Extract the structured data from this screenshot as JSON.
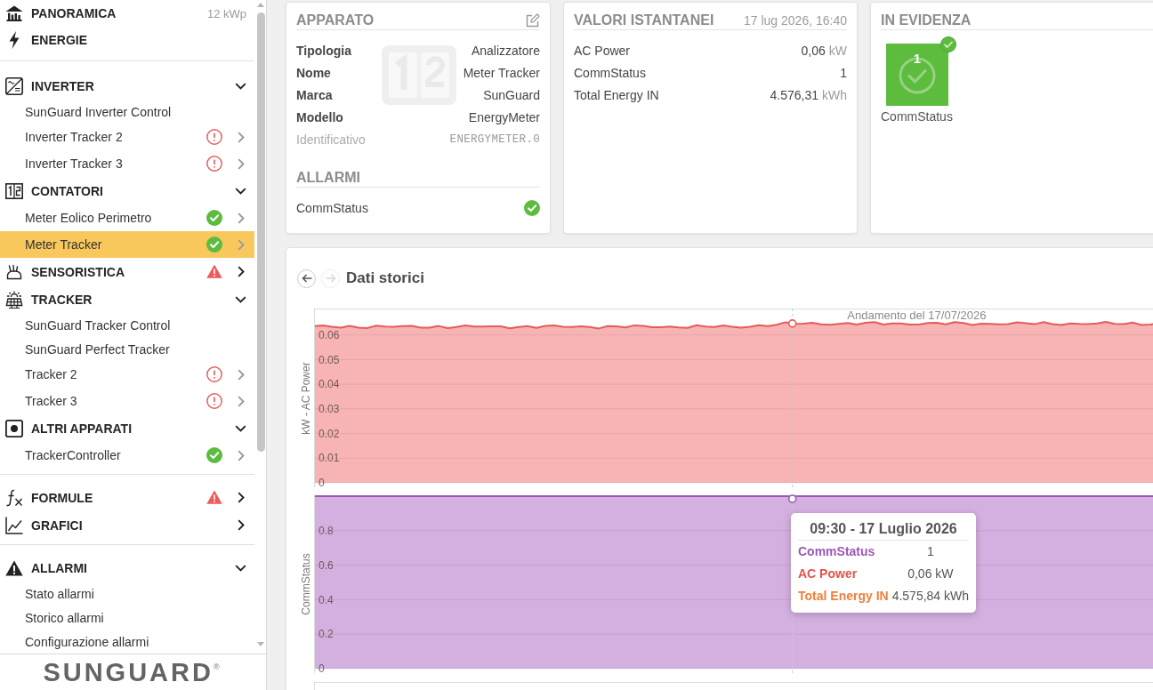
{
  "sidebar": {
    "groups": [
      {
        "sections": [
          {
            "label": "PANORAMICA",
            "value": "12 kWp"
          },
          {
            "label": "ENERGIE"
          }
        ]
      },
      {
        "sections": [
          {
            "label": "INVERTER",
            "warning": false,
            "expanded": true,
            "children": [
              {
                "label": "SunGuard Inverter Control",
                "alarm": false,
                "ok": false,
                "has_submenu": false,
                "selected": false
              },
              {
                "label": "Inverter Tracker 2",
                "alarm": true,
                "ok": false,
                "has_submenu": true,
                "selected": false
              },
              {
                "label": "Inverter Tracker 3",
                "alarm": true,
                "ok": false,
                "has_submenu": true,
                "selected": false
              }
            ]
          },
          {
            "label": "CONTATORI",
            "warning": false,
            "expanded": true,
            "children": [
              {
                "label": "Meter Eolico Perimetro",
                "alarm": false,
                "ok": true,
                "has_submenu": true,
                "selected": false
              },
              {
                "label": "Meter Tracker",
                "alarm": false,
                "ok": true,
                "has_submenu": true,
                "selected": true
              }
            ]
          },
          {
            "label": "SENSORISTICA",
            "warning": true,
            "expanded": false
          },
          {
            "label": "TRACKER",
            "warning": false,
            "expanded": true,
            "children": [
              {
                "label": "SunGuard Tracker Control",
                "alarm": false,
                "ok": false,
                "has_submenu": false,
                "selected": false
              },
              {
                "label": "SunGuard Perfect Tracker",
                "alarm": false,
                "ok": false,
                "has_submenu": false,
                "selected": false
              },
              {
                "label": "Tracker 2",
                "alarm": true,
                "ok": false,
                "has_submenu": true,
                "selected": false
              },
              {
                "label": "Tracker 3",
                "alarm": true,
                "ok": false,
                "has_submenu": true,
                "selected": false
              }
            ]
          },
          {
            "label": "ALTRI APPARATI",
            "warning": false,
            "expanded": true,
            "children": [
              {
                "label": "TrackerController",
                "alarm": false,
                "ok": true,
                "has_submenu": true,
                "selected": false
              }
            ]
          }
        ]
      },
      {
        "sections": [
          {
            "label": "FORMULE",
            "warning": true,
            "expanded": false
          },
          {
            "label": "GRAFICI",
            "warning": false,
            "expanded": false
          }
        ]
      },
      {
        "sections": [
          {
            "label": "ALLARMI",
            "warning": false,
            "expanded": true,
            "children": [
              {
                "label": "Stato allarmi",
                "alarm": false,
                "ok": false,
                "has_submenu": false,
                "selected": false
              },
              {
                "label": "Storico allarmi",
                "alarm": false,
                "ok": false,
                "has_submenu": false,
                "selected": false
              },
              {
                "label": "Configurazione allarmi",
                "alarm": false,
                "ok": false,
                "has_submenu": false,
                "selected": false
              }
            ]
          }
        ]
      }
    ],
    "logo": {
      "text": "SUNGUARD",
      "mark": "®"
    }
  },
  "device_card": {
    "title": "APPARATO",
    "rows": [
      {
        "label": "Tipologia",
        "value": "Analizzatore",
        "kind": "field"
      },
      {
        "label": "Nome",
        "value": "Meter Tracker",
        "kind": "field"
      },
      {
        "label": "Marca",
        "value": "SunGuard",
        "kind": "field"
      },
      {
        "label": "Modello",
        "value": "EnergyMeter",
        "kind": "field"
      },
      {
        "label": "Identificativo",
        "value": "ENERGYMETER.0",
        "kind": "identifier"
      }
    ],
    "alarms_title": "ALLARMI",
    "alarms": [
      {
        "label": "CommStatus",
        "ok": true
      }
    ]
  },
  "live_values_card": {
    "title": "VALORI ISTANTANEI",
    "timestamp": "17 lug 2026, 16:40",
    "rows": [
      {
        "label": "AC Power",
        "value": "0,06",
        "unit": "kW"
      },
      {
        "label": "CommStatus",
        "value": "1"
      },
      {
        "label": "Total Energy IN",
        "value": "4.576,31",
        "unit": "kWh"
      }
    ]
  },
  "highlight_card": {
    "title": "IN EVIDENZA",
    "tiles": [
      {
        "label": "CommStatus",
        "value": "1",
        "ok": true
      }
    ]
  },
  "history": {
    "title": "Dati storici",
    "nav": [
      {
        "kind": "back",
        "disabled": false
      },
      {
        "kind": "forward",
        "disabled": true
      }
    ],
    "charts": [
      {
        "title": "Andamento del 17/07/2026",
        "ylabel": "kW - AC Power",
        "y_tick_labels": [
          "0.06",
          "0.05",
          "0.04",
          "0.03",
          "0.02",
          "0.01",
          "0"
        ]
      },
      {
        "ylabel": "CommStatus",
        "y_tick_labels": [
          "0.8",
          "0.6",
          "0.4",
          "0.2",
          "0"
        ]
      }
    ],
    "tooltip": {
      "title": "09:30 - 17 Luglio 2026",
      "rows": [
        {
          "label": "CommStatus",
          "value": "1",
          "color": "#9b59b6"
        },
        {
          "label": "AC Power",
          "value": "0,06 kW",
          "color": "#e5534b"
        },
        {
          "label": "Total Energy IN",
          "value": "4.575,84 kWh",
          "color": "#f07f3c"
        }
      ]
    }
  }
}
